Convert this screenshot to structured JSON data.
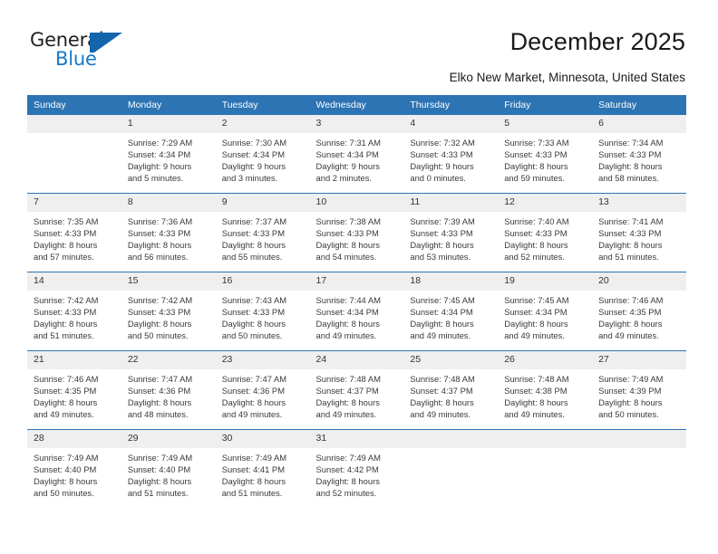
{
  "brand": {
    "name_top": "General",
    "name_bottom": "Blue",
    "mark": "triangle-logo",
    "color_dark": "#231f20",
    "color_blue": "#1878c8"
  },
  "header": {
    "title": "December 2025",
    "subtitle": "Elko New Market, Minnesota, United States"
  },
  "theme": {
    "header_blue": "#2c74b3",
    "daynum_gray": "#efefef",
    "text": "#3a3a3a"
  },
  "calendar": {
    "weekdays": [
      "Sunday",
      "Monday",
      "Tuesday",
      "Wednesday",
      "Thursday",
      "Friday",
      "Saturday"
    ],
    "weeks": [
      [
        {
          "day": "",
          "sunrise": "",
          "sunset": "",
          "daylight1": "",
          "daylight2": ""
        },
        {
          "day": "1",
          "sunrise": "Sunrise: 7:29 AM",
          "sunset": "Sunset: 4:34 PM",
          "daylight1": "Daylight: 9 hours",
          "daylight2": "and 5 minutes."
        },
        {
          "day": "2",
          "sunrise": "Sunrise: 7:30 AM",
          "sunset": "Sunset: 4:34 PM",
          "daylight1": "Daylight: 9 hours",
          "daylight2": "and 3 minutes."
        },
        {
          "day": "3",
          "sunrise": "Sunrise: 7:31 AM",
          "sunset": "Sunset: 4:34 PM",
          "daylight1": "Daylight: 9 hours",
          "daylight2": "and 2 minutes."
        },
        {
          "day": "4",
          "sunrise": "Sunrise: 7:32 AM",
          "sunset": "Sunset: 4:33 PM",
          "daylight1": "Daylight: 9 hours",
          "daylight2": "and 0 minutes."
        },
        {
          "day": "5",
          "sunrise": "Sunrise: 7:33 AM",
          "sunset": "Sunset: 4:33 PM",
          "daylight1": "Daylight: 8 hours",
          "daylight2": "and 59 minutes."
        },
        {
          "day": "6",
          "sunrise": "Sunrise: 7:34 AM",
          "sunset": "Sunset: 4:33 PM",
          "daylight1": "Daylight: 8 hours",
          "daylight2": "and 58 minutes."
        }
      ],
      [
        {
          "day": "7",
          "sunrise": "Sunrise: 7:35 AM",
          "sunset": "Sunset: 4:33 PM",
          "daylight1": "Daylight: 8 hours",
          "daylight2": "and 57 minutes."
        },
        {
          "day": "8",
          "sunrise": "Sunrise: 7:36 AM",
          "sunset": "Sunset: 4:33 PM",
          "daylight1": "Daylight: 8 hours",
          "daylight2": "and 56 minutes."
        },
        {
          "day": "9",
          "sunrise": "Sunrise: 7:37 AM",
          "sunset": "Sunset: 4:33 PM",
          "daylight1": "Daylight: 8 hours",
          "daylight2": "and 55 minutes."
        },
        {
          "day": "10",
          "sunrise": "Sunrise: 7:38 AM",
          "sunset": "Sunset: 4:33 PM",
          "daylight1": "Daylight: 8 hours",
          "daylight2": "and 54 minutes."
        },
        {
          "day": "11",
          "sunrise": "Sunrise: 7:39 AM",
          "sunset": "Sunset: 4:33 PM",
          "daylight1": "Daylight: 8 hours",
          "daylight2": "and 53 minutes."
        },
        {
          "day": "12",
          "sunrise": "Sunrise: 7:40 AM",
          "sunset": "Sunset: 4:33 PM",
          "daylight1": "Daylight: 8 hours",
          "daylight2": "and 52 minutes."
        },
        {
          "day": "13",
          "sunrise": "Sunrise: 7:41 AM",
          "sunset": "Sunset: 4:33 PM",
          "daylight1": "Daylight: 8 hours",
          "daylight2": "and 51 minutes."
        }
      ],
      [
        {
          "day": "14",
          "sunrise": "Sunrise: 7:42 AM",
          "sunset": "Sunset: 4:33 PM",
          "daylight1": "Daylight: 8 hours",
          "daylight2": "and 51 minutes."
        },
        {
          "day": "15",
          "sunrise": "Sunrise: 7:42 AM",
          "sunset": "Sunset: 4:33 PM",
          "daylight1": "Daylight: 8 hours",
          "daylight2": "and 50 minutes."
        },
        {
          "day": "16",
          "sunrise": "Sunrise: 7:43 AM",
          "sunset": "Sunset: 4:33 PM",
          "daylight1": "Daylight: 8 hours",
          "daylight2": "and 50 minutes."
        },
        {
          "day": "17",
          "sunrise": "Sunrise: 7:44 AM",
          "sunset": "Sunset: 4:34 PM",
          "daylight1": "Daylight: 8 hours",
          "daylight2": "and 49 minutes."
        },
        {
          "day": "18",
          "sunrise": "Sunrise: 7:45 AM",
          "sunset": "Sunset: 4:34 PM",
          "daylight1": "Daylight: 8 hours",
          "daylight2": "and 49 minutes."
        },
        {
          "day": "19",
          "sunrise": "Sunrise: 7:45 AM",
          "sunset": "Sunset: 4:34 PM",
          "daylight1": "Daylight: 8 hours",
          "daylight2": "and 49 minutes."
        },
        {
          "day": "20",
          "sunrise": "Sunrise: 7:46 AM",
          "sunset": "Sunset: 4:35 PM",
          "daylight1": "Daylight: 8 hours",
          "daylight2": "and 49 minutes."
        }
      ],
      [
        {
          "day": "21",
          "sunrise": "Sunrise: 7:46 AM",
          "sunset": "Sunset: 4:35 PM",
          "daylight1": "Daylight: 8 hours",
          "daylight2": "and 49 minutes."
        },
        {
          "day": "22",
          "sunrise": "Sunrise: 7:47 AM",
          "sunset": "Sunset: 4:36 PM",
          "daylight1": "Daylight: 8 hours",
          "daylight2": "and 48 minutes."
        },
        {
          "day": "23",
          "sunrise": "Sunrise: 7:47 AM",
          "sunset": "Sunset: 4:36 PM",
          "daylight1": "Daylight: 8 hours",
          "daylight2": "and 49 minutes."
        },
        {
          "day": "24",
          "sunrise": "Sunrise: 7:48 AM",
          "sunset": "Sunset: 4:37 PM",
          "daylight1": "Daylight: 8 hours",
          "daylight2": "and 49 minutes."
        },
        {
          "day": "25",
          "sunrise": "Sunrise: 7:48 AM",
          "sunset": "Sunset: 4:37 PM",
          "daylight1": "Daylight: 8 hours",
          "daylight2": "and 49 minutes."
        },
        {
          "day": "26",
          "sunrise": "Sunrise: 7:48 AM",
          "sunset": "Sunset: 4:38 PM",
          "daylight1": "Daylight: 8 hours",
          "daylight2": "and 49 minutes."
        },
        {
          "day": "27",
          "sunrise": "Sunrise: 7:49 AM",
          "sunset": "Sunset: 4:39 PM",
          "daylight1": "Daylight: 8 hours",
          "daylight2": "and 50 minutes."
        }
      ],
      [
        {
          "day": "28",
          "sunrise": "Sunrise: 7:49 AM",
          "sunset": "Sunset: 4:40 PM",
          "daylight1": "Daylight: 8 hours",
          "daylight2": "and 50 minutes."
        },
        {
          "day": "29",
          "sunrise": "Sunrise: 7:49 AM",
          "sunset": "Sunset: 4:40 PM",
          "daylight1": "Daylight: 8 hours",
          "daylight2": "and 51 minutes."
        },
        {
          "day": "30",
          "sunrise": "Sunrise: 7:49 AM",
          "sunset": "Sunset: 4:41 PM",
          "daylight1": "Daylight: 8 hours",
          "daylight2": "and 51 minutes."
        },
        {
          "day": "31",
          "sunrise": "Sunrise: 7:49 AM",
          "sunset": "Sunset: 4:42 PM",
          "daylight1": "Daylight: 8 hours",
          "daylight2": "and 52 minutes."
        },
        {
          "day": "",
          "sunrise": "",
          "sunset": "",
          "daylight1": "",
          "daylight2": ""
        },
        {
          "day": "",
          "sunrise": "",
          "sunset": "",
          "daylight1": "",
          "daylight2": ""
        },
        {
          "day": "",
          "sunrise": "",
          "sunset": "",
          "daylight1": "",
          "daylight2": ""
        }
      ]
    ]
  }
}
